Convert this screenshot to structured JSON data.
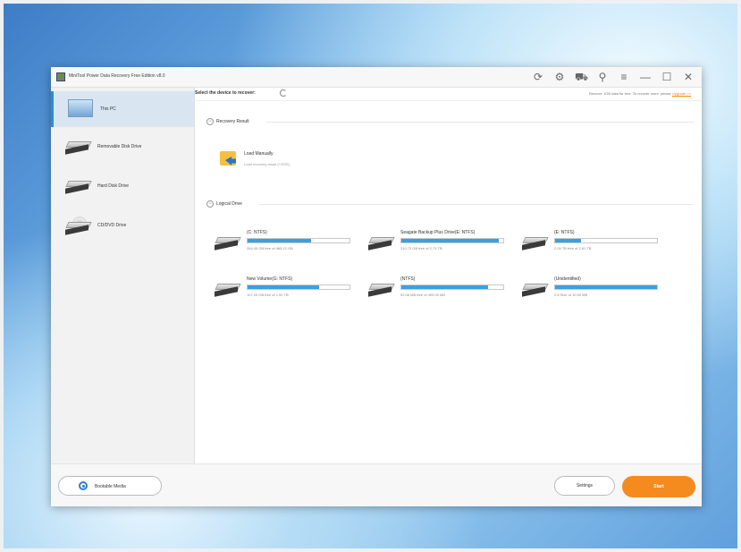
{
  "window": {
    "title": "MiniTool Power Data Recovery Free Edition v8.0"
  },
  "titlebar_icons": [
    "refresh-icon",
    "gear-icon",
    "cart-icon",
    "search-icon",
    "menu-icon",
    "minimize-icon",
    "maximize-icon",
    "close-icon"
  ],
  "titlebar_glyphs": [
    "⟳",
    "⚙",
    "⛟",
    "⚲",
    "≡",
    "—",
    "☐",
    "✕"
  ],
  "sidebar": {
    "items": [
      {
        "label": "This PC",
        "icon": "monitor-icon",
        "active": true
      },
      {
        "label": "Removable Disk Drive",
        "icon": "drive-icon",
        "active": false
      },
      {
        "label": "Hard Disk Drive",
        "icon": "drive-icon",
        "active": false
      },
      {
        "label": "CD/DVD Drive",
        "icon": "cd-drive-icon",
        "active": false
      }
    ]
  },
  "main": {
    "select_label": "Select the device to recover:",
    "recover_note": "Recover 1GB data for free. To recover more, please",
    "upgrade_link": "Upgrade >>",
    "recovery_result": {
      "title": "Recovery Result",
      "load_manually_title": "Load Manually",
      "load_manually_sub": "Load recovery result (*.RSS)"
    },
    "logical_drive": {
      "title": "Logical Drive",
      "drives": [
        {
          "name": "(C: NTFS)",
          "size": "264.45 GB free of 465.12 GB",
          "fill": 0.62
        },
        {
          "name": "Seagate Backup Plus Drive(E: NTFS)",
          "size": "310.73 GB free of 2.73 TB",
          "fill": 0.96
        },
        {
          "name": "(E: NTFS)",
          "size": "2.04 TB free of 2.61 TB",
          "fill": 0.25
        },
        {
          "name": "New Volume(G: NTFS)",
          "size": "107.20 GB free of 1.92 TB",
          "fill": 0.7
        },
        {
          "name": "(NTFS)",
          "size": "92.08 MB free of 499.00 MB",
          "fill": 0.85
        },
        {
          "name": "(Unidentified)",
          "size": "2.8 Size of 10.00 MB",
          "fill": 1.0
        }
      ]
    }
  },
  "bottom": {
    "bootable_label": "Bootable Media",
    "settings_label": "Settings",
    "start_label": "Start"
  },
  "colors": {
    "accent": "#2c8ed6",
    "progress": "#3aa0e0",
    "start": "#f58a1f",
    "upgrade": "#f08a00"
  }
}
